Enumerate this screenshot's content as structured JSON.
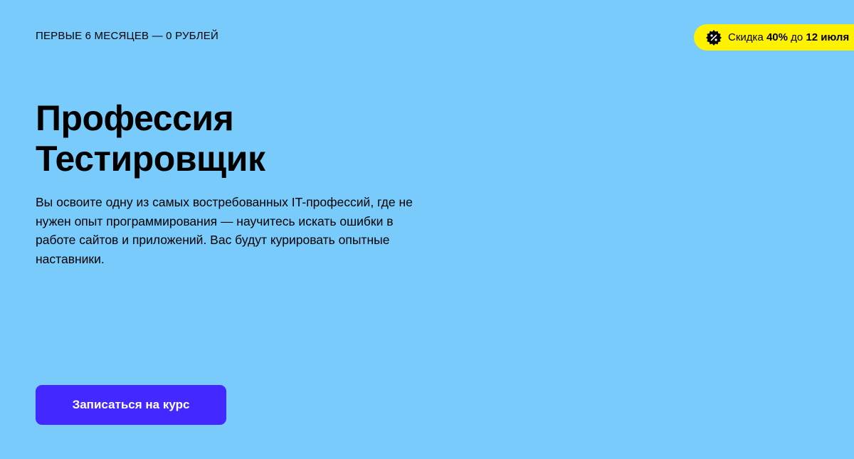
{
  "hero": {
    "eyebrow": "ПЕРВЫЕ 6 МЕСЯЦЕВ — 0 РУБЛЕЙ",
    "promo": {
      "icon": "percent-badge-icon",
      "prefix": "Скидка ",
      "discount": "40%",
      "middle": " до ",
      "date": "12 июля"
    },
    "title_line1": "Профессия",
    "title_line2": "Тестировщик",
    "description": "Вы освоите одну из самых востребованных IT-профессий, где не нужен опыт программирования — научитесь искать ошибки в работе сайтов и приложений. Вас будут курировать опытные наставники.",
    "cta_label": "Записаться на курс"
  },
  "colors": {
    "background": "#78cbfa",
    "promo_pill": "#fff200",
    "cta": "#4328ff",
    "text": "#000000"
  }
}
